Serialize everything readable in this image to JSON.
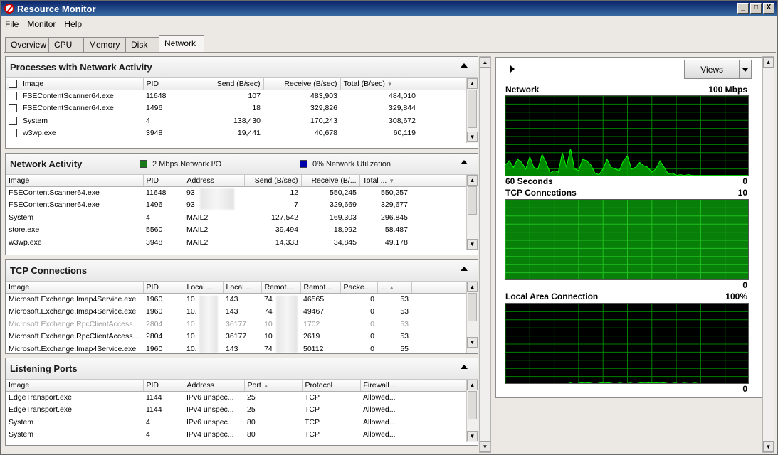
{
  "window": {
    "title": "Resource Monitor",
    "buttons": {
      "minimize": "_",
      "maximize": "□",
      "close": "X"
    }
  },
  "menu": [
    "File",
    "Monitor",
    "Help"
  ],
  "tabs": [
    {
      "label": "Overview"
    },
    {
      "label": "CPU"
    },
    {
      "label": "Memory"
    },
    {
      "label": "Disk"
    },
    {
      "label": "Network",
      "active": true
    }
  ],
  "processes": {
    "title": "Processes with Network Activity",
    "headers": [
      "Image",
      "PID",
      "Send (B/sec)",
      "Receive (B/sec)",
      "Total (B/sec)"
    ],
    "rows": [
      [
        "FSEContentScanner64.exe",
        "11648",
        "107",
        "483,903",
        "484,010"
      ],
      [
        "FSEContentScanner64.exe",
        "1496",
        "18",
        "329,826",
        "329,844"
      ],
      [
        "System",
        "4",
        "138,430",
        "170,243",
        "308,672"
      ],
      [
        "w3wp.exe",
        "3948",
        "19,441",
        "40,678",
        "60,119"
      ]
    ]
  },
  "network_activity": {
    "title": "Network Activity",
    "legend_io": "2 Mbps Network I/O",
    "legend_util": "0% Network Utilization",
    "colors": {
      "io": "#1a7a1a",
      "util": "#0000aa"
    },
    "headers": [
      "Image",
      "PID",
      "Address",
      "Send (B/sec)",
      "Receive (B/...",
      "Total ..."
    ],
    "rows": [
      [
        "FSEContentScanner64.exe",
        "11648",
        "93",
        "12",
        "550,245",
        "550,257"
      ],
      [
        "FSEContentScanner64.exe",
        "1496",
        "93",
        "7",
        "329,669",
        "329,677"
      ],
      [
        "System",
        "4",
        "MAIL2",
        "127,542",
        "169,303",
        "296,845"
      ],
      [
        "store.exe",
        "5560",
        "MAIL2",
        "39,494",
        "18,992",
        "58,487"
      ],
      [
        "w3wp.exe",
        "3948",
        "MAIL2",
        "14,333",
        "34,845",
        "49,178"
      ]
    ]
  },
  "tcp": {
    "title": "TCP Connections",
    "headers": [
      "Image",
      "PID",
      "Local ...",
      "Local ...",
      "Remot...",
      "Remot...",
      "Packe...",
      "..."
    ],
    "rows": [
      [
        "Microsoft.Exchange.Imap4Service.exe",
        "1960",
        "10.",
        "143",
        "74",
        "46565",
        "0",
        "53"
      ],
      [
        "Microsoft.Exchange.Imap4Service.exe",
        "1960",
        "10.",
        "143",
        "74",
        "49467",
        "0",
        "53"
      ],
      [
        "Microsoft.Exchange.RpcClientAccess...",
        "2804",
        "10.",
        "36177",
        "10",
        "1702",
        "0",
        "53"
      ],
      [
        "Microsoft.Exchange.RpcClientAccess...",
        "2804",
        "10.",
        "36177",
        "10",
        "2619",
        "0",
        "53"
      ],
      [
        "Microsoft.Exchange.Imap4Service.exe",
        "1960",
        "10.",
        "143",
        "74",
        "50112",
        "0",
        "55"
      ]
    ]
  },
  "ports": {
    "title": "Listening Ports",
    "headers": [
      "Image",
      "PID",
      "Address",
      "Port",
      "Protocol",
      "Firewall ..."
    ],
    "rows": [
      [
        "EdgeTransport.exe",
        "1144",
        "IPv6 unspec...",
        "25",
        "TCP",
        "Allowed..."
      ],
      [
        "EdgeTransport.exe",
        "1144",
        "IPv4 unspec...",
        "25",
        "TCP",
        "Allowed..."
      ],
      [
        "System",
        "4",
        "IPv6 unspec...",
        "80",
        "TCP",
        "Allowed..."
      ],
      [
        "System",
        "4",
        "IPv4 unspec...",
        "80",
        "TCP",
        "Allowed..."
      ]
    ]
  },
  "right": {
    "views_label": "Views",
    "graphs": [
      {
        "title": "Network",
        "max": "100 Mbps",
        "bottom_left": "60 Seconds",
        "min": "0"
      },
      {
        "title": "TCP Connections",
        "max": "10",
        "min": "0"
      },
      {
        "title": "Local Area Connection",
        "max": "100%",
        "min": "0"
      }
    ],
    "colors": {
      "grid": "#008000",
      "fill": "#00a000",
      "line": "#00ff00"
    }
  }
}
